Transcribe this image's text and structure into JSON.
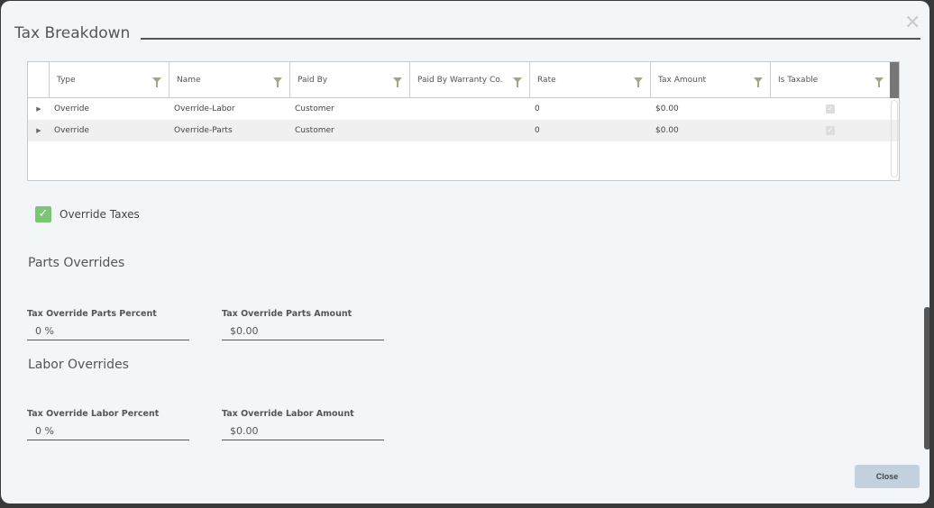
{
  "dialog": {
    "title": "Tax Breakdown",
    "close_icon": "close-icon"
  },
  "grid": {
    "columns": [
      "Type",
      "Name",
      "Paid By",
      "Paid By Warranty Co.",
      "Rate",
      "Tax Amount",
      "Is Taxable"
    ],
    "rows": [
      {
        "type": "Override",
        "name": "Override-Labor",
        "paid_by": "Customer",
        "paid_by_warranty": "",
        "rate": "0",
        "tax_amount": "$0.00",
        "is_taxable": true
      },
      {
        "type": "Override",
        "name": "Override-Parts",
        "paid_by": "Customer",
        "paid_by_warranty": "",
        "rate": "0",
        "tax_amount": "$0.00",
        "is_taxable": true
      }
    ]
  },
  "override_taxes": {
    "label": "Override Taxes",
    "checked": true
  },
  "parts": {
    "heading": "Parts Overrides",
    "percent_label": "Tax Override Parts Percent",
    "percent_value": "0 %",
    "amount_label": "Tax Override Parts Amount",
    "amount_value": "$0.00"
  },
  "labor": {
    "heading": "Labor Overrides",
    "percent_label": "Tax Override Labor Percent",
    "percent_value": "0 %",
    "amount_label": "Tax Override Labor Amount",
    "amount_value": "$0.00"
  },
  "footer": {
    "close_label": "Close"
  },
  "colors": {
    "accent_check": "#7cc576",
    "close_button": "#c3d0de",
    "filter_icon": "#a0a888"
  }
}
